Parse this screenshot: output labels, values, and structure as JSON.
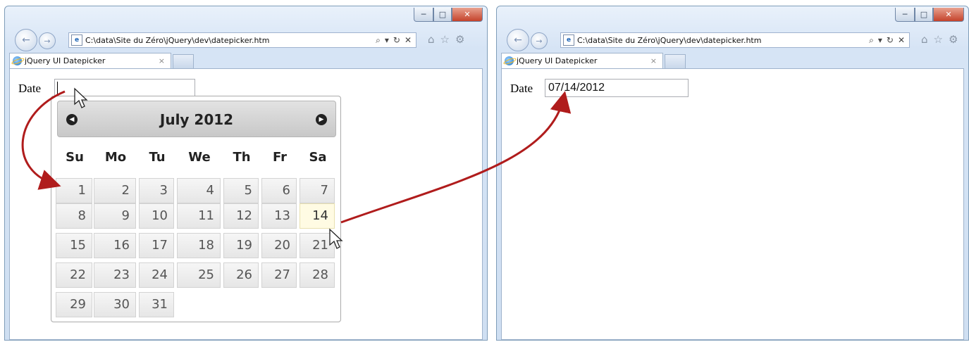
{
  "window_controls": {
    "minimize": "─",
    "maximize": "□",
    "close": "✕"
  },
  "browser": {
    "url": "C:\\data\\Site du Zéro\\jQuery\\dev\\datepicker.htm",
    "tab_title": "jQuery UI Datepicker",
    "tab_close": "×",
    "address_tools": {
      "search": "⌕",
      "dropdown": "▾",
      "refresh": "↻",
      "stop": "✕"
    },
    "toolbar_icons": {
      "home": "⌂",
      "favorites": "☆",
      "tools": "⚙"
    },
    "nav": {
      "back": "←",
      "forward": "→"
    }
  },
  "left_page": {
    "date_label": "Date",
    "date_value": ""
  },
  "right_page": {
    "date_label": "Date",
    "date_value": "07/14/2012"
  },
  "datepicker": {
    "title": "July 2012",
    "prev_glyph": "◀",
    "next_glyph": "▶",
    "weekdays": [
      "Su",
      "Mo",
      "Tu",
      "We",
      "Th",
      "Fr",
      "Sa"
    ],
    "weeks": [
      [
        "1",
        "2",
        "3",
        "4",
        "5",
        "6",
        "7"
      ],
      [
        "8",
        "9",
        "10",
        "11",
        "12",
        "13",
        "14"
      ],
      [
        "15",
        "16",
        "17",
        "18",
        "19",
        "20",
        "21"
      ],
      [
        "22",
        "23",
        "24",
        "25",
        "26",
        "27",
        "28"
      ],
      [
        "29",
        "30",
        "31",
        "",
        "",
        "",
        ""
      ]
    ],
    "highlighted": "14"
  },
  "colors": {
    "arrow": "#b01c1c",
    "highlight_bg": "#fffbe3"
  }
}
